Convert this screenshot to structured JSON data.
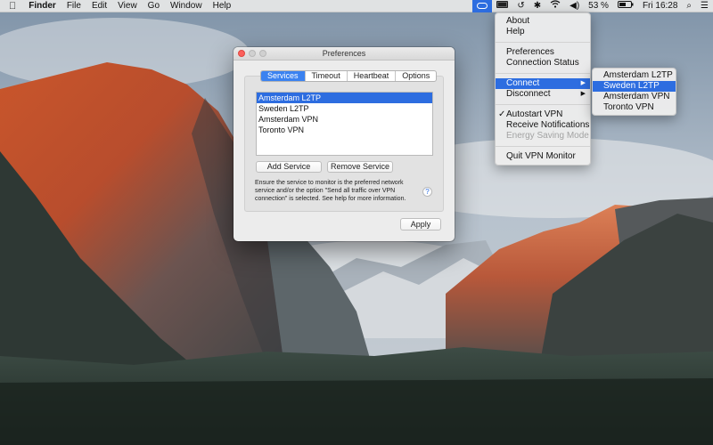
{
  "menubar": {
    "apple_icon": "apple-logo-icon",
    "app_name": "Finder",
    "menus": [
      "File",
      "Edit",
      "View",
      "Go",
      "Window",
      "Help"
    ],
    "status_icons": [
      "vpn-pill-icon",
      "keyboard-icon",
      "time-machine-icon",
      "bluetooth-icon",
      "wifi-icon",
      "volume-icon"
    ],
    "battery_percent": "53 %",
    "clock": "Fri 16:28",
    "search_icon": "⌕",
    "list_icon": "☰"
  },
  "vpn_menu": {
    "about": "About",
    "help": "Help",
    "preferences": "Preferences",
    "connection_status": "Connection Status",
    "connect": "Connect",
    "disconnect": "Disconnect",
    "autostart": "Autostart VPN",
    "autostart_checked": true,
    "receive_notifications": "Receive Notifications",
    "energy_saving": "Energy Saving Mode",
    "quit": "Quit VPN Monitor"
  },
  "connect_submenu": [
    "Amsterdam L2TP",
    "Sweden L2TP",
    "Amsterdam VPN",
    "Toronto VPN"
  ],
  "connect_submenu_highlighted": "Sweden L2TP",
  "prefs": {
    "title": "Preferences",
    "tabs": [
      "Services",
      "Timeout",
      "Heartbeat",
      "Options"
    ],
    "active_tab": "Services",
    "services": [
      "Amsterdam L2TP",
      "Sweden L2TP",
      "Amsterdam VPN",
      "Toronto VPN"
    ],
    "selected_service": "Amsterdam L2TP",
    "add_service": "Add Service",
    "remove_service": "Remove Service",
    "help_text": "Ensure the service to monitor is the preferred network service and/or the option \"Send all traffic over VPN connection\" is selected. See help for more information.",
    "help_button": "?",
    "apply": "Apply"
  },
  "colors": {
    "highlight": "#2d6de0",
    "close_button": "#fc605c"
  }
}
